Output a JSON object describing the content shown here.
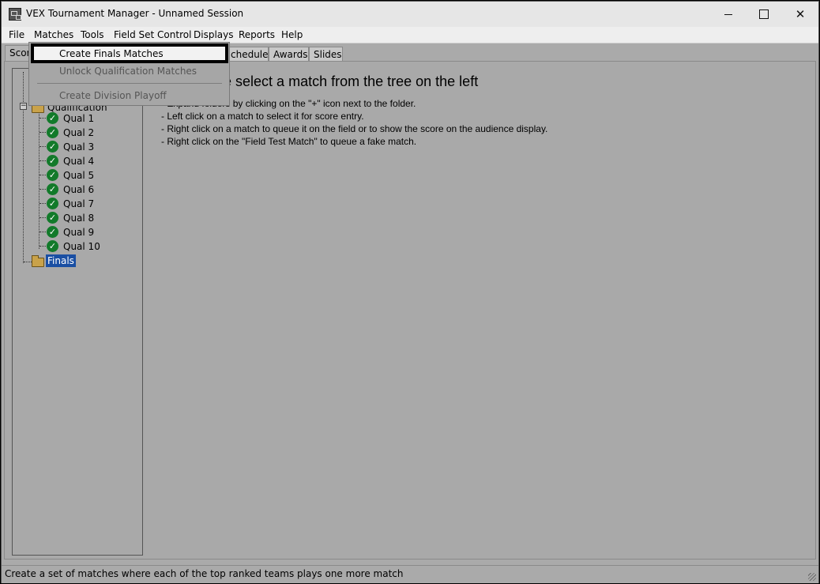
{
  "window": {
    "title": "VEX Tournament Manager - Unnamed Session"
  },
  "menubar": {
    "items": [
      "File",
      "Matches",
      "Tools",
      "Field Set Control",
      "Displays",
      "Reports",
      "Help"
    ]
  },
  "tabs": {
    "items": [
      "Scor",
      "chedule",
      "Awards",
      "Slides"
    ],
    "selected": "Scor"
  },
  "matches_menu": {
    "items": [
      {
        "label": "Create Finals Matches",
        "enabled": true
      },
      {
        "label": "Unlock Qualification Matches",
        "enabled": false
      },
      {
        "label": "Create Division Playoff",
        "enabled": false
      }
    ]
  },
  "tree": {
    "qual_folder_label": "Qualification",
    "quals": [
      "Qual 1",
      "Qual 2",
      "Qual 3",
      "Qual 4",
      "Qual 5",
      "Qual 6",
      "Qual 7",
      "Qual 8",
      "Qual 9",
      "Qual 10"
    ],
    "finals_label": "Finals"
  },
  "detail": {
    "heading": "Please select a match from the tree on the left",
    "instructions": [
      "- Expand folders by clicking on the \"+\" icon next to the folder.",
      "- Left click on a match to select it for score entry.",
      "- Right click on a match to queue it on the field or to show the score on the audience display.",
      "- Right click on the \"Field Test Match\" to queue a fake match."
    ]
  },
  "statusbar": {
    "text": "Create a set of matches where each of the top ranked teams plays one more match"
  }
}
